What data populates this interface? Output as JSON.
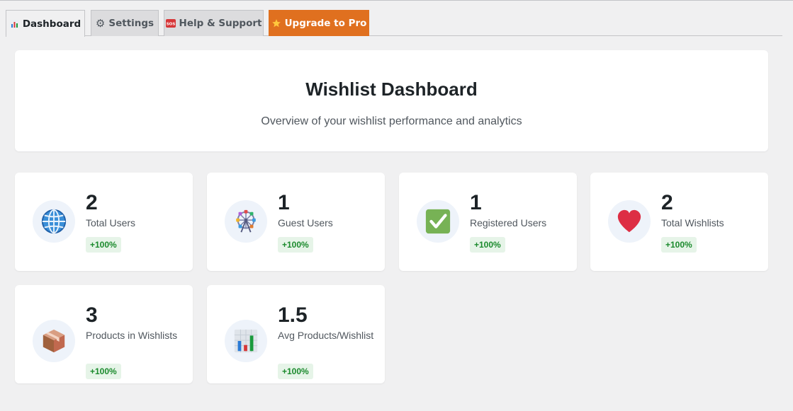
{
  "tabs": [
    {
      "label": "Dashboard",
      "icon": "bar-chart-icon",
      "active": true
    },
    {
      "label": "Settings",
      "icon": "gear-icon",
      "active": false
    },
    {
      "label": "Help & Support",
      "icon": "sos-icon",
      "icon_text": "SOS",
      "active": false
    },
    {
      "label": "Upgrade to Pro",
      "icon": "star-icon",
      "active": false
    }
  ],
  "header": {
    "title": "Wishlist Dashboard",
    "subtitle": "Overview of your wishlist performance and analytics"
  },
  "stats": [
    {
      "value": "2",
      "label": "Total Users",
      "change": "+100%",
      "icon": "globe-icon"
    },
    {
      "value": "1",
      "label": "Guest Users",
      "change": "+100%",
      "icon": "ferris-wheel-icon"
    },
    {
      "value": "1",
      "label": "Registered Users",
      "change": "+100%",
      "icon": "check-mark-icon"
    },
    {
      "value": "2",
      "label": "Total Wishlists",
      "change": "+100%",
      "icon": "heart-icon"
    },
    {
      "value": "3",
      "label": "Products in Wishlists",
      "change": "+100%",
      "icon": "package-icon"
    },
    {
      "value": "1.5",
      "label": "Avg Products/Wishlist",
      "change": "+100%",
      "icon": "bar-chart-icon"
    }
  ],
  "colors": {
    "pro_tab": "#e0701f",
    "badge_bg": "#e6f4e8",
    "badge_text": "#1a8a2c",
    "icon_circle": "#eef3fa"
  }
}
